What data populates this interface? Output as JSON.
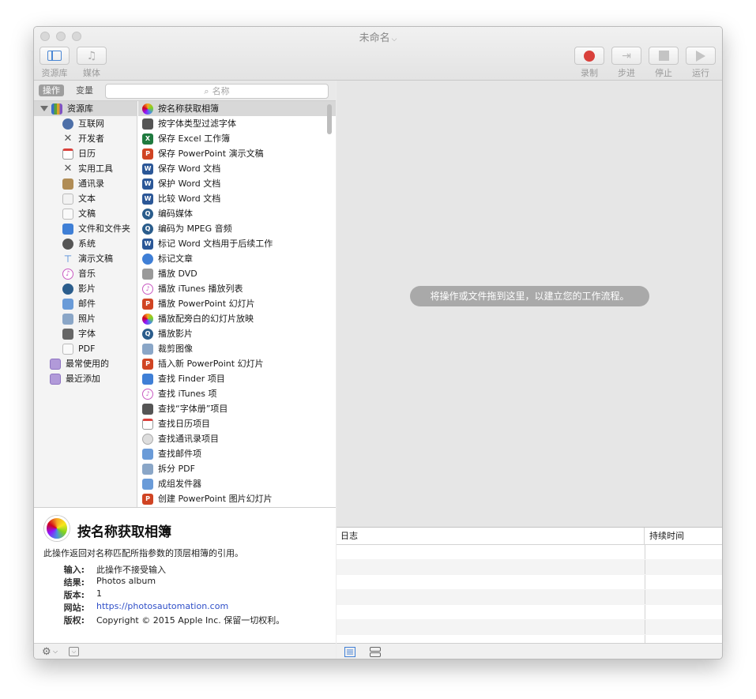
{
  "window": {
    "title": "未命名"
  },
  "toolbar": {
    "library_label": "资源库",
    "media_label": "媒体",
    "record_label": "录制",
    "step_label": "步进",
    "stop_label": "停止",
    "run_label": "运行"
  },
  "tabs": {
    "actions_label": "操作",
    "variables_label": "变量"
  },
  "search": {
    "placeholder": "名称"
  },
  "library": {
    "root": "资源库",
    "items": [
      "互联网",
      "开发者",
      "日历",
      "实用工具",
      "通讯录",
      "文本",
      "文稿",
      "文件和文件夹",
      "系统",
      "演示文稿",
      "音乐",
      "影片",
      "邮件",
      "照片",
      "字体",
      "PDF"
    ],
    "groups": [
      "最常使用的",
      "最近添加"
    ]
  },
  "actions": [
    "按名称获取相簿",
    "按字体类型过滤字体",
    "保存 Excel 工作簿",
    "保存 PowerPoint 演示文稿",
    "保存 Word 文档",
    "保护 Word 文档",
    "比较 Word 文档",
    "编码媒体",
    "编码为 MPEG 音频",
    "标记 Word 文档用于后续工作",
    "标记文章",
    "播放 DVD",
    "播放 iTunes 播放列表",
    "播放 PowerPoint 幻灯片",
    "播放配旁白的幻灯片放映",
    "播放影片",
    "裁剪图像",
    "插入新 PowerPoint 幻灯片",
    "查找 Finder 项目",
    "查找 iTunes 项",
    "查找“字体册”项目",
    "查找日历项目",
    "查找通讯录项目",
    "查找邮件项",
    "拆分 PDF",
    "成组发件器",
    "创建 PowerPoint 图片幻灯片"
  ],
  "detail": {
    "title": "按名称获取相簿",
    "description": "此操作返回对名称匹配所指参数的顶层相簿的引用。",
    "input_key": "输入:",
    "input_val": "此操作不接受输入",
    "result_key": "结果:",
    "result_val": "Photos album",
    "version_key": "版本:",
    "version_val": "1",
    "website_key": "网站:",
    "website_val": "https://photosautomation.com",
    "copyright_key": "版权:",
    "copyright_val": "Copyright © 2015 Apple Inc. 保留一切权利。"
  },
  "canvas": {
    "hint": "将操作或文件拖到这里，以建立您的工作流程。"
  },
  "log": {
    "col_log": "日志",
    "col_duration": "持续时间"
  },
  "colors": {
    "record": "#d9403b",
    "accent": "#4a87d4",
    "hint_bg": "#a9a9a9"
  }
}
